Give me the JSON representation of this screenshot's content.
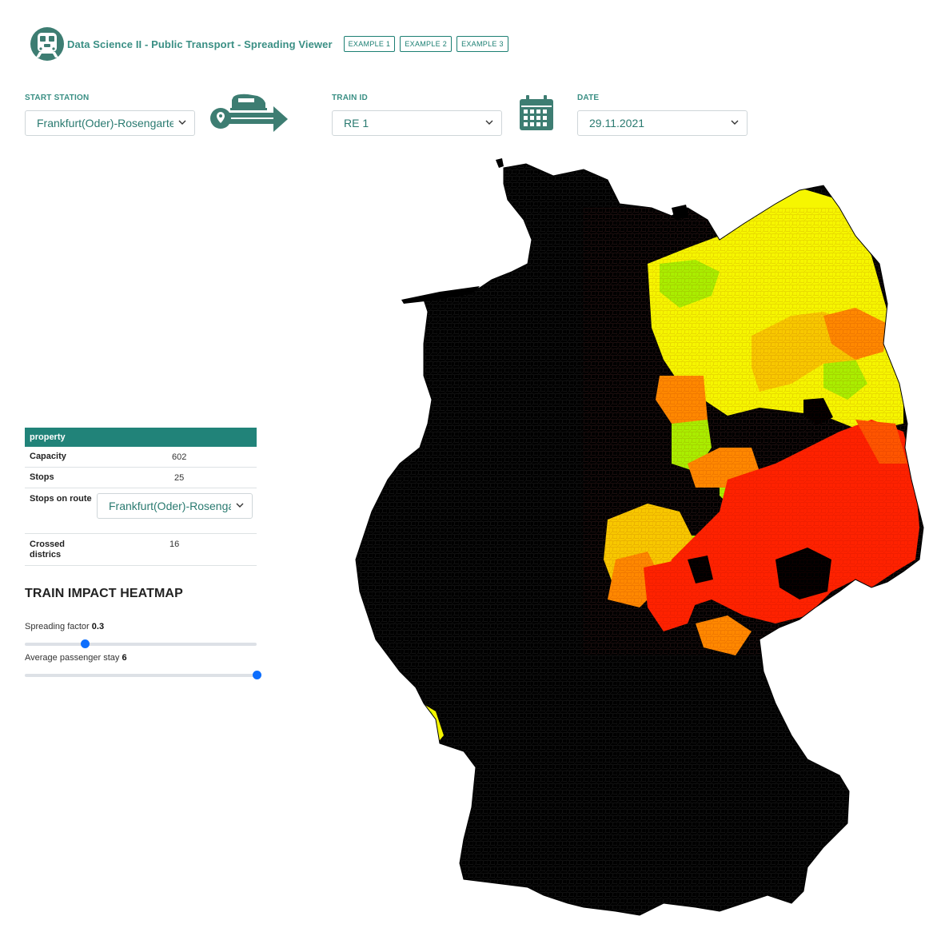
{
  "header": {
    "title": "Data Science II - Public Transport - Spreading Viewer",
    "examples": [
      "EXAMPLE 1",
      "EXAMPLE 2",
      "EXAMPLE 3"
    ]
  },
  "controls": {
    "start_station_label": "START STATION",
    "start_station_value": "Frankfurt(Oder)-Rosengarten",
    "train_id_label": "TRAIN ID",
    "train_id_value": "RE 1",
    "date_label": "DATE",
    "date_value": "29.11.2021"
  },
  "properties": {
    "header": "property",
    "capacity_label": "Capacity",
    "capacity_value": "602",
    "stops_label": "Stops",
    "stops_value": "25",
    "stops_on_route_label": "Stops on route",
    "stops_on_route_value": "Frankfurt(Oder)-Rosengarten",
    "crossed_label": "Crossed districs",
    "crossed_value": "16"
  },
  "heatmap": {
    "title": "TRAIN IMPACT HEATMAP",
    "spreading_label": "Spreading factor",
    "spreading_value": "0.3",
    "spreading_fraction": 0.26,
    "stay_label": "Average passenger stay",
    "stay_value": "6",
    "stay_fraction": 1.0
  },
  "colors": {
    "accent": "#218379",
    "map_base": "#000000",
    "impact_low": "#aaee00",
    "impact_mid_low": "#f6f600",
    "impact_mid": "#f8c800",
    "impact_mid_high": "#ff8800",
    "impact_high": "#ff2200"
  }
}
